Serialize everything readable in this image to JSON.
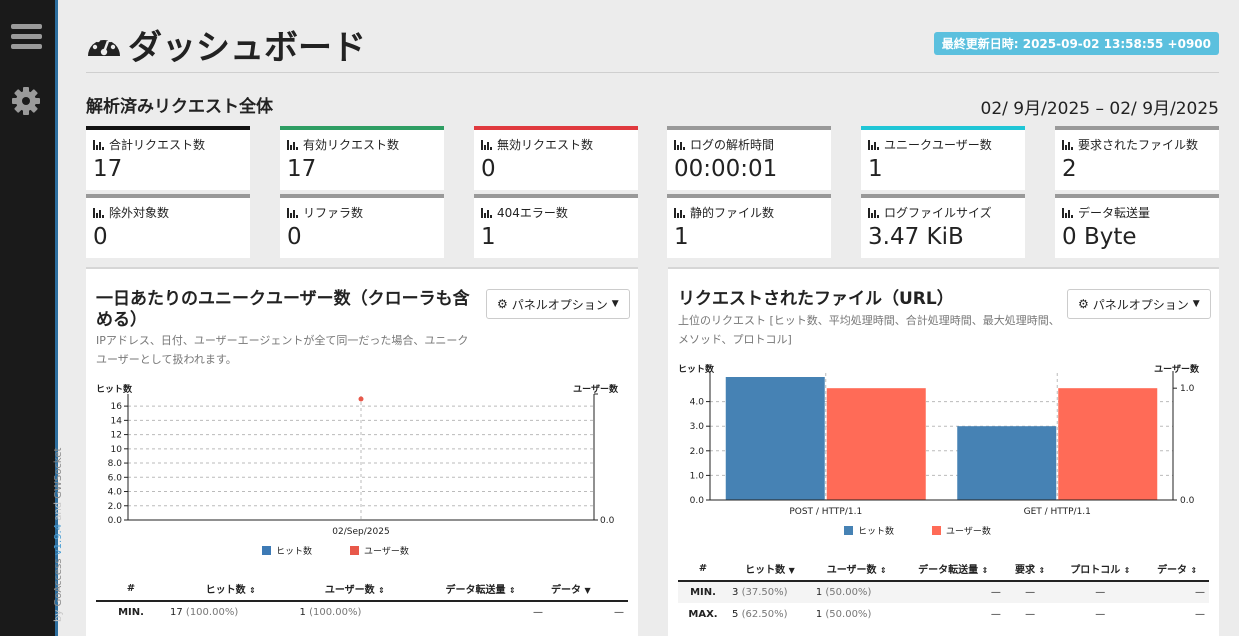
{
  "sidebar": {
    "credit_prefix": "by ",
    "credit_app": "GoAccess",
    "credit_version": " v1.9.4",
    "credit_and": " and ",
    "credit_ws": "GWSocket"
  },
  "header": {
    "title": "ダッシュボード",
    "last_updated": "最終更新日時: 2025-09-02 13:58:55 +0900"
  },
  "overall": {
    "title": "解析済みリクエスト全体",
    "date_range": "02/ 9月/2025 – 02/ 9月/2025",
    "cards": [
      {
        "label": "合計リクエスト数",
        "value": "17",
        "color": "#111111"
      },
      {
        "label": "有効リクエスト数",
        "value": "17",
        "color": "#2e9e63"
      },
      {
        "label": "無効リクエスト数",
        "value": "0",
        "color": "#e0393e"
      },
      {
        "label": "ログの解析時間",
        "value": "00:00:01",
        "color": "#999999"
      },
      {
        "label": "ユニークユーザー数",
        "value": "1",
        "color": "#1fc6d6"
      },
      {
        "label": "要求されたファイル数",
        "value": "2",
        "color": "#999999"
      },
      {
        "label": "除外対象数",
        "value": "0",
        "color": "#999999"
      },
      {
        "label": "リファラ数",
        "value": "0",
        "color": "#999999"
      },
      {
        "label": "404エラー数",
        "value": "1",
        "color": "#999999"
      },
      {
        "label": "静的ファイル数",
        "value": "1",
        "color": "#999999"
      },
      {
        "label": "ログファイルサイズ",
        "value": "3.47 KiB",
        "color": "#999999"
      },
      {
        "label": "データ転送量",
        "value": "0 Byte",
        "color": "#999999"
      }
    ]
  },
  "visitors_panel": {
    "title": "一日あたりのユニークユーザー数（クローラも含める）",
    "subtitle": "IPアドレス、日付、ユーザーエージェントが全て同一だった場合、ユニークユーザーとして扱われます。",
    "options_label": "パネルオプション",
    "legend": [
      "ヒット数",
      "ユーザー数"
    ],
    "table_headers": [
      "#",
      "ヒット数",
      "ユーザー数",
      "データ転送量",
      "データ"
    ],
    "rows": [
      {
        "label": "MIN.",
        "hits": "17",
        "hits_pct": "(100.00%)",
        "visitors": "1",
        "visitors_pct": "(100.00%)",
        "bw": "—",
        "data": "—"
      }
    ]
  },
  "requests_panel": {
    "title": "リクエストされたファイル（URL）",
    "subtitle": "上位のリクエスト [ヒット数、平均処理時間、合計処理時間、最大処理時間、メソッド、プロトコル]",
    "options_label": "パネルオプション",
    "legend": [
      "ヒット数",
      "ユーザー数"
    ],
    "table_headers": [
      "#",
      "ヒット数",
      "ユーザー数",
      "データ転送量",
      "要求",
      "プロトコル",
      "データ"
    ],
    "rows": [
      {
        "label": "MIN.",
        "hits": "3",
        "hits_pct": "(37.50%)",
        "visitors": "1",
        "visitors_pct": "(50.00%)",
        "bw": "—",
        "req": "—",
        "proto": "—",
        "data": "—"
      },
      {
        "label": "MAX.",
        "hits": "5",
        "hits_pct": "(62.50%)",
        "visitors": "1",
        "visitors_pct": "(50.00%)",
        "bw": "—",
        "req": "—",
        "proto": "—",
        "data": "—"
      }
    ]
  },
  "chart_data": [
    {
      "type": "line",
      "x": [
        "02/Sep/2025"
      ],
      "series": [
        {
          "name": "ヒット数",
          "values": [
            17
          ],
          "color": "#3d7ab5"
        },
        {
          "name": "ユーザー数",
          "values": [
            1
          ],
          "color": "#e8584a"
        }
      ],
      "ylabel_left": "ヒット数",
      "ylabel_right": "ユーザー数",
      "left_ticks": [
        "0.0",
        "2.0",
        "4.0",
        "6.0",
        "8.0",
        "10",
        "12",
        "14",
        "16"
      ],
      "right_ticks": [
        "0.0"
      ],
      "ylim_left": [
        0,
        17
      ],
      "grid": true
    },
    {
      "type": "bar",
      "categories": [
        "POST / HTTP/1.1",
        "GET / HTTP/1.1"
      ],
      "series": [
        {
          "name": "ヒット数",
          "values": [
            5,
            3
          ],
          "color": "#4682b4"
        },
        {
          "name": "ユーザー数",
          "values": [
            1,
            1
          ],
          "color": "#ff6b57"
        }
      ],
      "ylabel_left": "ヒット数",
      "ylabel_right": "ユーザー数",
      "left_ticks": [
        "0.0",
        "1.0",
        "2.0",
        "3.0",
        "4.0"
      ],
      "right_ticks": [
        "0.0",
        "1.0"
      ],
      "ylim_left": [
        0,
        5
      ],
      "ylim_right": [
        0,
        1.1
      ],
      "grid": true
    }
  ]
}
